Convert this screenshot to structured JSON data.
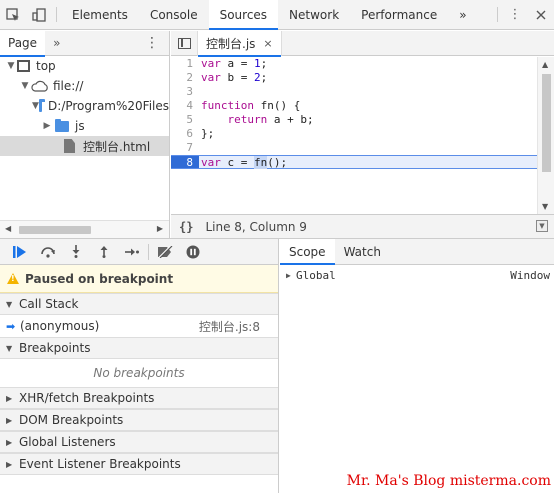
{
  "toolbar": {
    "tabs": [
      "Elements",
      "Console",
      "Sources",
      "Network",
      "Performance"
    ],
    "active_tab": "Sources",
    "more_tabs": "»",
    "menu": "⋮"
  },
  "navigator": {
    "tab": "Page",
    "more": "»",
    "menu": "⋮",
    "tree": [
      {
        "label": "top",
        "icon": "frame-icon"
      },
      {
        "label": "file://",
        "icon": "cloud-icon"
      },
      {
        "label": "D:/Program%20Files",
        "icon": "folder-icon"
      },
      {
        "label": "js",
        "icon": "folder-icon"
      },
      {
        "label": "控制台.html",
        "icon": "file-icon"
      }
    ]
  },
  "editor": {
    "file_tab": "控制台.js",
    "close": "×",
    "lines": [
      {
        "num": "1",
        "code": "var a = 1;"
      },
      {
        "num": "2",
        "code": "var b = 2;"
      },
      {
        "num": "3",
        "code": ""
      },
      {
        "num": "4",
        "code": "function fn() {"
      },
      {
        "num": "5",
        "code": "    return a + b;"
      },
      {
        "num": "6",
        "code": "};"
      },
      {
        "num": "7",
        "code": ""
      },
      {
        "num": "8",
        "code": "var c = fn();"
      }
    ],
    "status_braces": "{}",
    "status_text": "Line 8, Column 9"
  },
  "debugger": {
    "paused_text": "Paused on breakpoint",
    "call_stack": {
      "title": "Call Stack",
      "frames": [
        {
          "name": "(anonymous)",
          "location": "控制台.js:8"
        }
      ]
    },
    "breakpoints": {
      "title": "Breakpoints",
      "empty": "No breakpoints"
    },
    "collapsed_sections": [
      "XHR/fetch Breakpoints",
      "DOM Breakpoints",
      "Global Listeners",
      "Event Listener Breakpoints"
    ]
  },
  "scope_panel": {
    "tabs": [
      "Scope",
      "Watch"
    ],
    "active_tab": "Scope",
    "rows": [
      {
        "name": "Global",
        "value": "Window"
      }
    ]
  },
  "watermark": "Mr. Ma's Blog  misterma.com",
  "colors": {
    "accent": "#1a73e8",
    "exec_line": "#e7eefc",
    "paused_bg": "#fffbe5",
    "watermark": "#e00000"
  }
}
